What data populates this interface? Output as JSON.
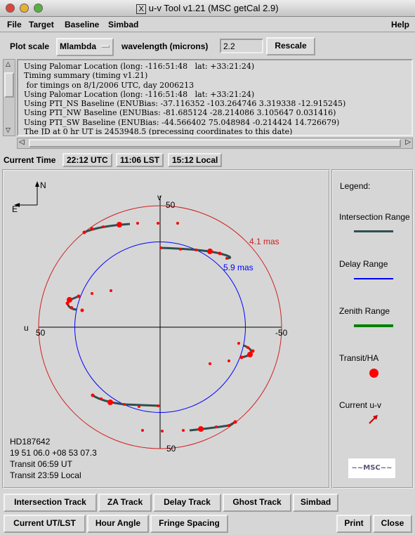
{
  "window": {
    "title": "u-v Tool v1.21 (MSC getCal 2.9)",
    "x_glyph": "X"
  },
  "menu": [
    "File",
    "Target",
    "Baseline",
    "Simbad",
    "Help"
  ],
  "toolbar": {
    "plot_scale_label": "Plot scale",
    "plot_scale_value": "Mlambda",
    "wavelength_label": "wavelength (microns)",
    "wavelength_value": "2.2",
    "rescale": "Rescale"
  },
  "log_lines": [
    "Using Palomar Location (long: -116:51:48   lat: +33:21:24)",
    "Timing summary (timing v1.21)",
    " for timings on 8/1/2006 UTC, day 2006213",
    "Using Palomar Location (long: -116:51:48   lat: +33:21:24)",
    "Using PTI_NS Baseline (ENUBias: -37.116352 -103.264746 3.319338 -12.915245)",
    "Using PTI_NW Baseline (ENUBias: -81.685124 -28.214086 3.105647 0.031416)",
    "Using PTI_SW Baseline (ENUBias: -44.566402 75.048984 -0.214424 14.726679)",
    "The JD at 0 hr UT is 2453948.5 (precessing coordinates to this date)"
  ],
  "time": {
    "label": "Current Time",
    "utc": "22:12 UTC",
    "lst": "11:06 LST",
    "local": "15:12 Local"
  },
  "plot": {
    "north": "N",
    "east": "E",
    "v_label": "v",
    "u_label": "u",
    "tick_top": "50",
    "tick_bottom": "50",
    "tick_left": "50",
    "tick_right": "-50",
    "outer_circle": "4.1 mas",
    "inner_circle": "5.9 mas",
    "target": {
      "name": "HD187642",
      "coords": "19 51 06.0  +08 53 07.3",
      "transit_ut": "Transit 06:59 UT",
      "transit_local": "Transit 23:59 Local"
    },
    "colors": {
      "track": "#2f4f4f",
      "points": "#ff0000",
      "outer": "#d02020",
      "inner": "#0000ff"
    }
  },
  "legend": {
    "title": "Legend:",
    "items": [
      {
        "label": "Intersection Range",
        "color": "#2f4f4f"
      },
      {
        "label": "Delay Range",
        "color": "#0000ff"
      },
      {
        "label": "Zenith Range",
        "color": "#008000"
      },
      {
        "label": "Transit/HA",
        "color": "#ff0000"
      },
      {
        "label": "Current u-v",
        "color": "#cc0000"
      }
    ],
    "logo": "MSC"
  },
  "buttons_row1": [
    "Intersection Track",
    "ZA Track",
    "Delay Track",
    "Ghost Track",
    "Simbad"
  ],
  "buttons_row2": [
    "Current UT/LST",
    "Hour Angle",
    "Fringe Spacing",
    "Print",
    "Close"
  ]
}
